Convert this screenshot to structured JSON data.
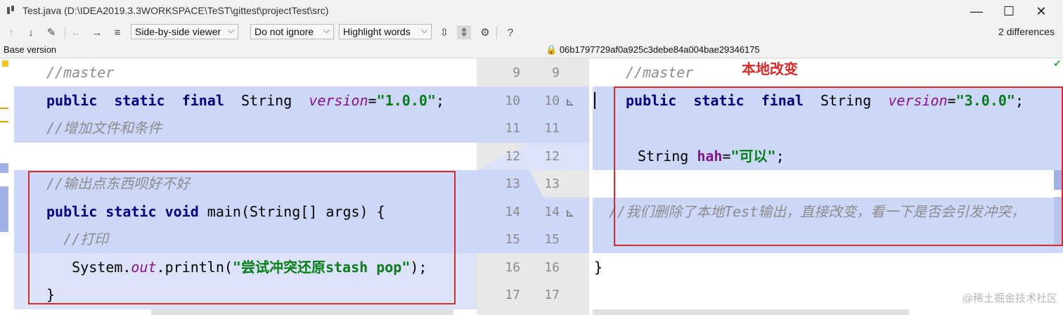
{
  "window": {
    "title": "Test.java (D:\\IDEA2019.3.3WORKSPACE\\TeST\\gittest\\projectTest\\src)",
    "minimize_glyph": "—",
    "maximize_glyph": "☐",
    "close_glyph": "✕"
  },
  "toolbar": {
    "viewer_mode": "Side-by-side viewer",
    "whitespace_mode": "Do not ignore",
    "highlight_mode": "Highlight words",
    "help": "?",
    "differences": "2 differences"
  },
  "header": {
    "left_label": "Base version",
    "right_revision": "06b1797729af0a925c3debe84a004bae29346175"
  },
  "left_lines": [
    {
      "num": "9",
      "parts": [
        [
          "cm",
          "//master"
        ]
      ]
    },
    {
      "num": "10",
      "parts": [
        [
          "kw",
          "public"
        ],
        [
          "",
          ""
        ],
        [
          "kw",
          "static"
        ],
        [
          "",
          ""
        ],
        [
          "kw",
          "final"
        ],
        [
          "",
          "  String  "
        ],
        [
          "fld",
          "version"
        ],
        [
          "",
          "="
        ],
        [
          "str",
          "\"1.0.0\""
        ],
        [
          "",
          ";"
        ]
      ]
    },
    {
      "num": "11",
      "parts": [
        [
          "cm",
          "//增加文件和条件"
        ]
      ]
    },
    {
      "num": "12",
      "parts": []
    },
    {
      "num": "13",
      "parts": [
        [
          "cm",
          "//输出点东西呗好不好"
        ]
      ]
    },
    {
      "num": "14",
      "parts": [
        [
          "kw",
          "public static void"
        ],
        [
          "",
          " main(String[] args) {"
        ]
      ]
    },
    {
      "num": "15",
      "parts": [
        [
          "cm",
          "  //打印"
        ]
      ]
    },
    {
      "num": "16",
      "parts": [
        [
          "",
          "   System."
        ],
        [
          "fld",
          "out"
        ],
        [
          "",
          ".println("
        ],
        [
          "str",
          "\"尝试冲突还原stash pop\""
        ],
        [
          "",
          ");"
        ]
      ]
    },
    {
      "num": "17",
      "parts": [
        [
          "",
          "}"
        ]
      ]
    }
  ],
  "right_lines": [
    {
      "num": "9",
      "parts": [
        [
          "cm",
          "//master"
        ]
      ]
    },
    {
      "num": "10",
      "parts": [
        [
          "kw",
          "public"
        ],
        [
          "",
          ""
        ],
        [
          "kw",
          "static"
        ],
        [
          "",
          ""
        ],
        [
          "kw",
          "final"
        ],
        [
          "",
          "  String  "
        ],
        [
          "fld",
          "version"
        ],
        [
          "",
          "="
        ],
        [
          "str",
          "\"3.0.0\""
        ],
        [
          "",
          ";"
        ]
      ]
    },
    {
      "num": "11",
      "parts": []
    },
    {
      "num": "12",
      "parts": [
        [
          "",
          " String "
        ],
        [
          "var",
          "hah"
        ],
        [
          "",
          "="
        ],
        [
          "str",
          "\"可以\""
        ],
        [
          "",
          ";"
        ]
      ]
    },
    {
      "num": "13",
      "parts": []
    },
    {
      "num": "14",
      "parts": [
        [
          "cm",
          "//我们删除了本地Test输出，直接改变，看一下是否会引发冲突，"
        ]
      ]
    },
    {
      "num": "15",
      "parts": []
    },
    {
      "num": "16",
      "parts": [
        [
          "",
          "}"
        ]
      ]
    },
    {
      "num": "17",
      "parts": []
    }
  ],
  "annotation": "本地改变",
  "watermark": "@稀土掘金技术社区",
  "colors": {
    "modified_band": "#cdd7f7",
    "annotation_red": "#d62b2b",
    "keyword": "#000080",
    "string": "#067d17"
  }
}
